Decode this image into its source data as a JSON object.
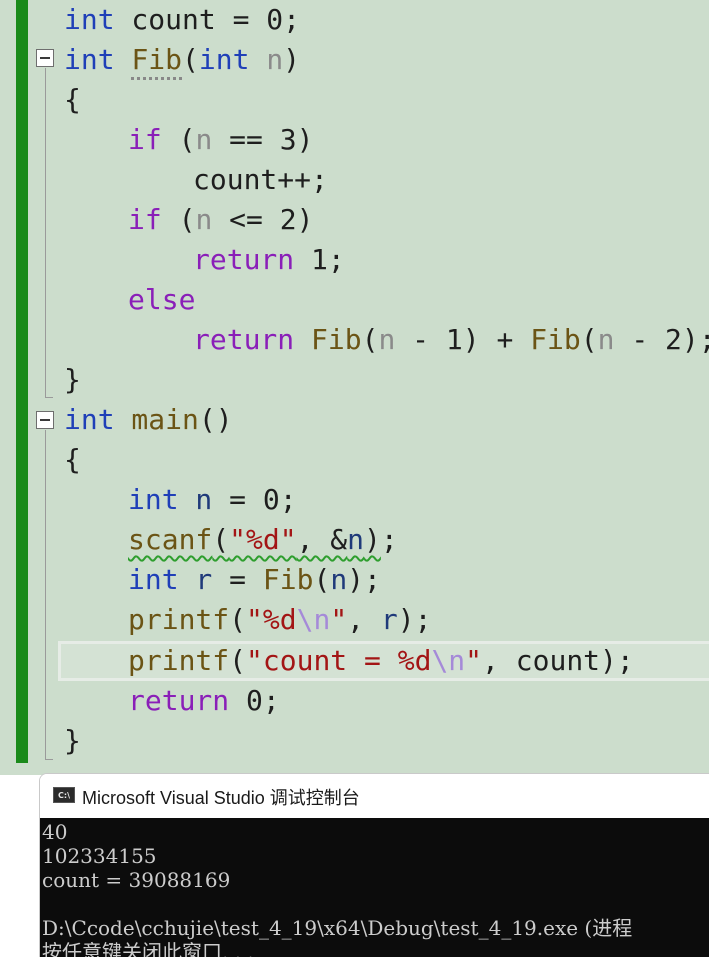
{
  "editor": {
    "line_current_highlight": "printf line",
    "code": {
      "l1": {
        "kw": "int",
        "rest": " count = 0;"
      },
      "l2": {
        "kw": "int",
        "name": "Fib",
        "open": "(",
        "kw2": "int",
        "param": "n",
        "close": ")"
      },
      "l3": {
        "text": "{"
      },
      "l4": {
        "kw": "if",
        "open": " (",
        "param": "n",
        "rest": " == 3)"
      },
      "l5": {
        "text": "count++;"
      },
      "l6": {
        "kw": "if",
        "open": " (",
        "param": "n",
        "rest": " <= 2)"
      },
      "l7": {
        "kw": "return",
        "rest": " 1;"
      },
      "l8": {
        "kw": "else"
      },
      "l9": {
        "kw": "return",
        "fn1": " Fib",
        "p1a": "(",
        "n1": "n",
        "p1b": " - 1)",
        "plus": " + ",
        "fn2": "Fib",
        "p2a": "(",
        "n2": "n",
        "p2b": " - 2);"
      },
      "l10": {
        "text": "}"
      },
      "l11": {
        "kw": "int",
        "name": " main",
        "rest": "()"
      },
      "l12": {
        "text": "{"
      },
      "l13": {
        "kw": "int",
        "var": " n",
        "rest": " = 0;"
      },
      "l14": {
        "fn": "scanf",
        "open": "(",
        "str": "\"%d\"",
        "mid": ", &",
        "var": "n",
        "close": ")",
        "end": ";"
      },
      "l15": {
        "kw": "int",
        "var": " r",
        "eq": " = ",
        "fn": "Fib",
        "open": "(",
        "var2": "n",
        "rest": ");"
      },
      "l16": {
        "fn": "printf",
        "open": "(",
        "str1": "\"%d",
        "esc": "\\n",
        "str2": "\"",
        "mid": ", ",
        "var": "r",
        "rest": ");"
      },
      "l17": {
        "fn": "printf",
        "open": "(",
        "str1": "\"count = %d",
        "esc": "\\n",
        "str2": "\"",
        "rest": ", count);"
      },
      "l18": {
        "kw": "return",
        "rest": " 0;"
      },
      "l19": {
        "text": "}"
      }
    }
  },
  "console": {
    "title": "Microsoft Visual Studio 调试控制台",
    "icon": "console-app-icon",
    "icon_text": "C:\\",
    "lines": [
      "40",
      "102334155",
      "count = 39088169",
      "",
      "D:\\Ccode\\cchujie\\test_4_19\\x64\\Debug\\test_4_19.exe (进程",
      "按任意键关闭此窗口. . ."
    ]
  },
  "colors": {
    "editor_bg": "#ccddcc",
    "change_bar": "#1a8a1a",
    "keyword_blue": "#1f3fb8",
    "keyword_purple": "#8a1fb8",
    "function": "#6b5415",
    "string": "#a31515",
    "console_bg": "#0c0c0c"
  }
}
